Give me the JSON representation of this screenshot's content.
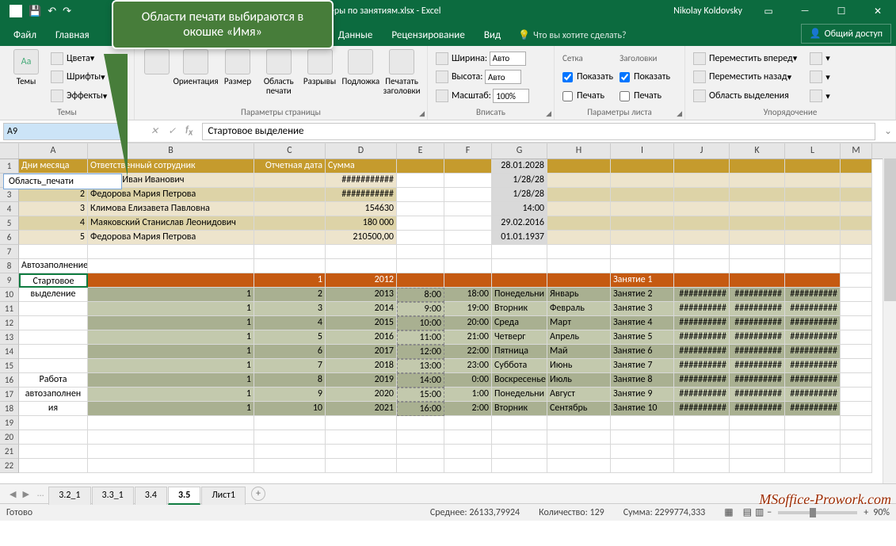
{
  "title": "Примеры по занятиям.xlsx - Excel",
  "user": "Nikolay Koldovsky",
  "callout": "Области печати выбираются в окошке «Имя»",
  "tabs": {
    "file": "Файл",
    "home": "Главная",
    "data": "Данные",
    "review": "Рецензирование",
    "view": "Вид",
    "tellme": "Что вы хотите сделать?",
    "share": "Общий доступ"
  },
  "ribbon": {
    "themes": {
      "label": "Темы",
      "btn": "Темы",
      "colors": "Цвета",
      "fonts": "Шрифты",
      "effects": "Эффекты"
    },
    "page": {
      "label": "Параметры страницы",
      "orientation": "Ориентация",
      "size": "Размер",
      "printarea": "Область печати",
      "breaks": "Разрывы",
      "background": "Подложка",
      "printtitles": "Печатать заголовки"
    },
    "fit": {
      "label": "Вписать",
      "width": "Ширина:",
      "height": "Высота:",
      "scale": "Масштаб:",
      "auto": "Авто",
      "scale_val": "100%"
    },
    "sheetopts": {
      "label": "Параметры листа",
      "grid": "Сетка",
      "headings": "Заголовки",
      "show": "Показать",
      "print": "Печать"
    },
    "arrange": {
      "label": "Упорядочение",
      "fwd": "Переместить вперед",
      "back": "Переместить назад",
      "selpane": "Область выделения"
    }
  },
  "namebox": "A9",
  "name_dropdown": "Область_печати",
  "formula": "Стартовое выделение",
  "columns": [
    "A",
    "B",
    "C",
    "D",
    "E",
    "F",
    "G",
    "H",
    "I",
    "J",
    "K",
    "L",
    "M"
  ],
  "table1": {
    "headers": {
      "a": "Дни месяца",
      "b": "Ответственный сотрудник",
      "c": "Отчетная дата",
      "d": "Сумма"
    },
    "rows": [
      {
        "a": "1",
        "b": "Иванов Иван Иванович",
        "c": "",
        "d": "###########",
        "g": "28.01.2028"
      },
      {
        "a": "2",
        "b": "Федорова Мария Петрова",
        "c": "",
        "d": "###########",
        "g": "1/28/28"
      },
      {
        "a": "3",
        "b": "Климова Елизавета Павловна",
        "c": "",
        "d": "154630",
        "g": "14:00",
        "gprev": "1/28/28"
      },
      {
        "a": "4",
        "b": "Маяковский Станислав Леонидович",
        "c": "",
        "d": "180 000",
        "g": "29.02.2016"
      },
      {
        "a": "5",
        "b": "Федорова Мария Петрова",
        "c": "",
        "d": "210500,00",
        "g": "01.01.1937"
      }
    ]
  },
  "autofill_label": "Автозаполнение",
  "startsel1": "Стартовое",
  "startsel2": "выделение",
  "worklabel1": "Работа",
  "worklabel2": "автозаполнен",
  "worklabel3": "ия",
  "autofill": [
    {
      "b": "",
      "c": "1",
      "d": "2012",
      "e": "",
      "f": "",
      "g": "",
      "h": "",
      "i": "Занятие 1",
      "hash": ""
    },
    {
      "b": "1",
      "c": "2",
      "d": "2013",
      "e": "8:00",
      "f": "18:00",
      "g": "Понедельни",
      "h": "Январь",
      "i": "Занятие 2",
      "hash": "##########"
    },
    {
      "b": "1",
      "c": "3",
      "d": "2014",
      "e": "9:00",
      "f": "19:00",
      "g": "Вторник",
      "h": "Февраль",
      "i": "Занятие 3",
      "hash": "##########"
    },
    {
      "b": "1",
      "c": "4",
      "d": "2015",
      "e": "10:00",
      "f": "20:00",
      "g": "Среда",
      "h": "Март",
      "i": "Занятие 4",
      "hash": "##########"
    },
    {
      "b": "1",
      "c": "5",
      "d": "2016",
      "e": "11:00",
      "f": "21:00",
      "g": "Четверг",
      "h": "Апрель",
      "i": "Занятие 5",
      "hash": "##########"
    },
    {
      "b": "1",
      "c": "6",
      "d": "2017",
      "e": "12:00",
      "f": "22:00",
      "g": "Пятница",
      "h": "Май",
      "i": "Занятие 6",
      "hash": "##########"
    },
    {
      "b": "1",
      "c": "7",
      "d": "2018",
      "e": "13:00",
      "f": "23:00",
      "g": "Суббота",
      "h": "Июнь",
      "i": "Занятие 7",
      "hash": "##########"
    },
    {
      "b": "1",
      "c": "8",
      "d": "2019",
      "e": "14:00",
      "f": "0:00",
      "g": "Воскресенье",
      "h": "Июль",
      "i": "Занятие 8",
      "hash": "##########"
    },
    {
      "b": "1",
      "c": "9",
      "d": "2020",
      "e": "15:00",
      "f": "1:00",
      "g": "Понедельни",
      "h": "Август",
      "i": "Занятие 9",
      "hash": "##########"
    },
    {
      "b": "1",
      "c": "10",
      "d": "2021",
      "e": "16:00",
      "f": "2:00",
      "g": "Вторник",
      "h": "Сентябрь",
      "i": "Занятие 10",
      "hash": "##########"
    }
  ],
  "sheets": [
    "3.2_1",
    "3.3_1",
    "3.4",
    "3.5",
    "Лист1"
  ],
  "active_sheet": "3.5",
  "status": {
    "ready": "Готово",
    "avg": "Среднее: 26133,79924",
    "count": "Количество: 129",
    "sum": "Сумма: 2299774,333",
    "zoom": "90%"
  },
  "watermark": "MSoffice-Prowork.com"
}
